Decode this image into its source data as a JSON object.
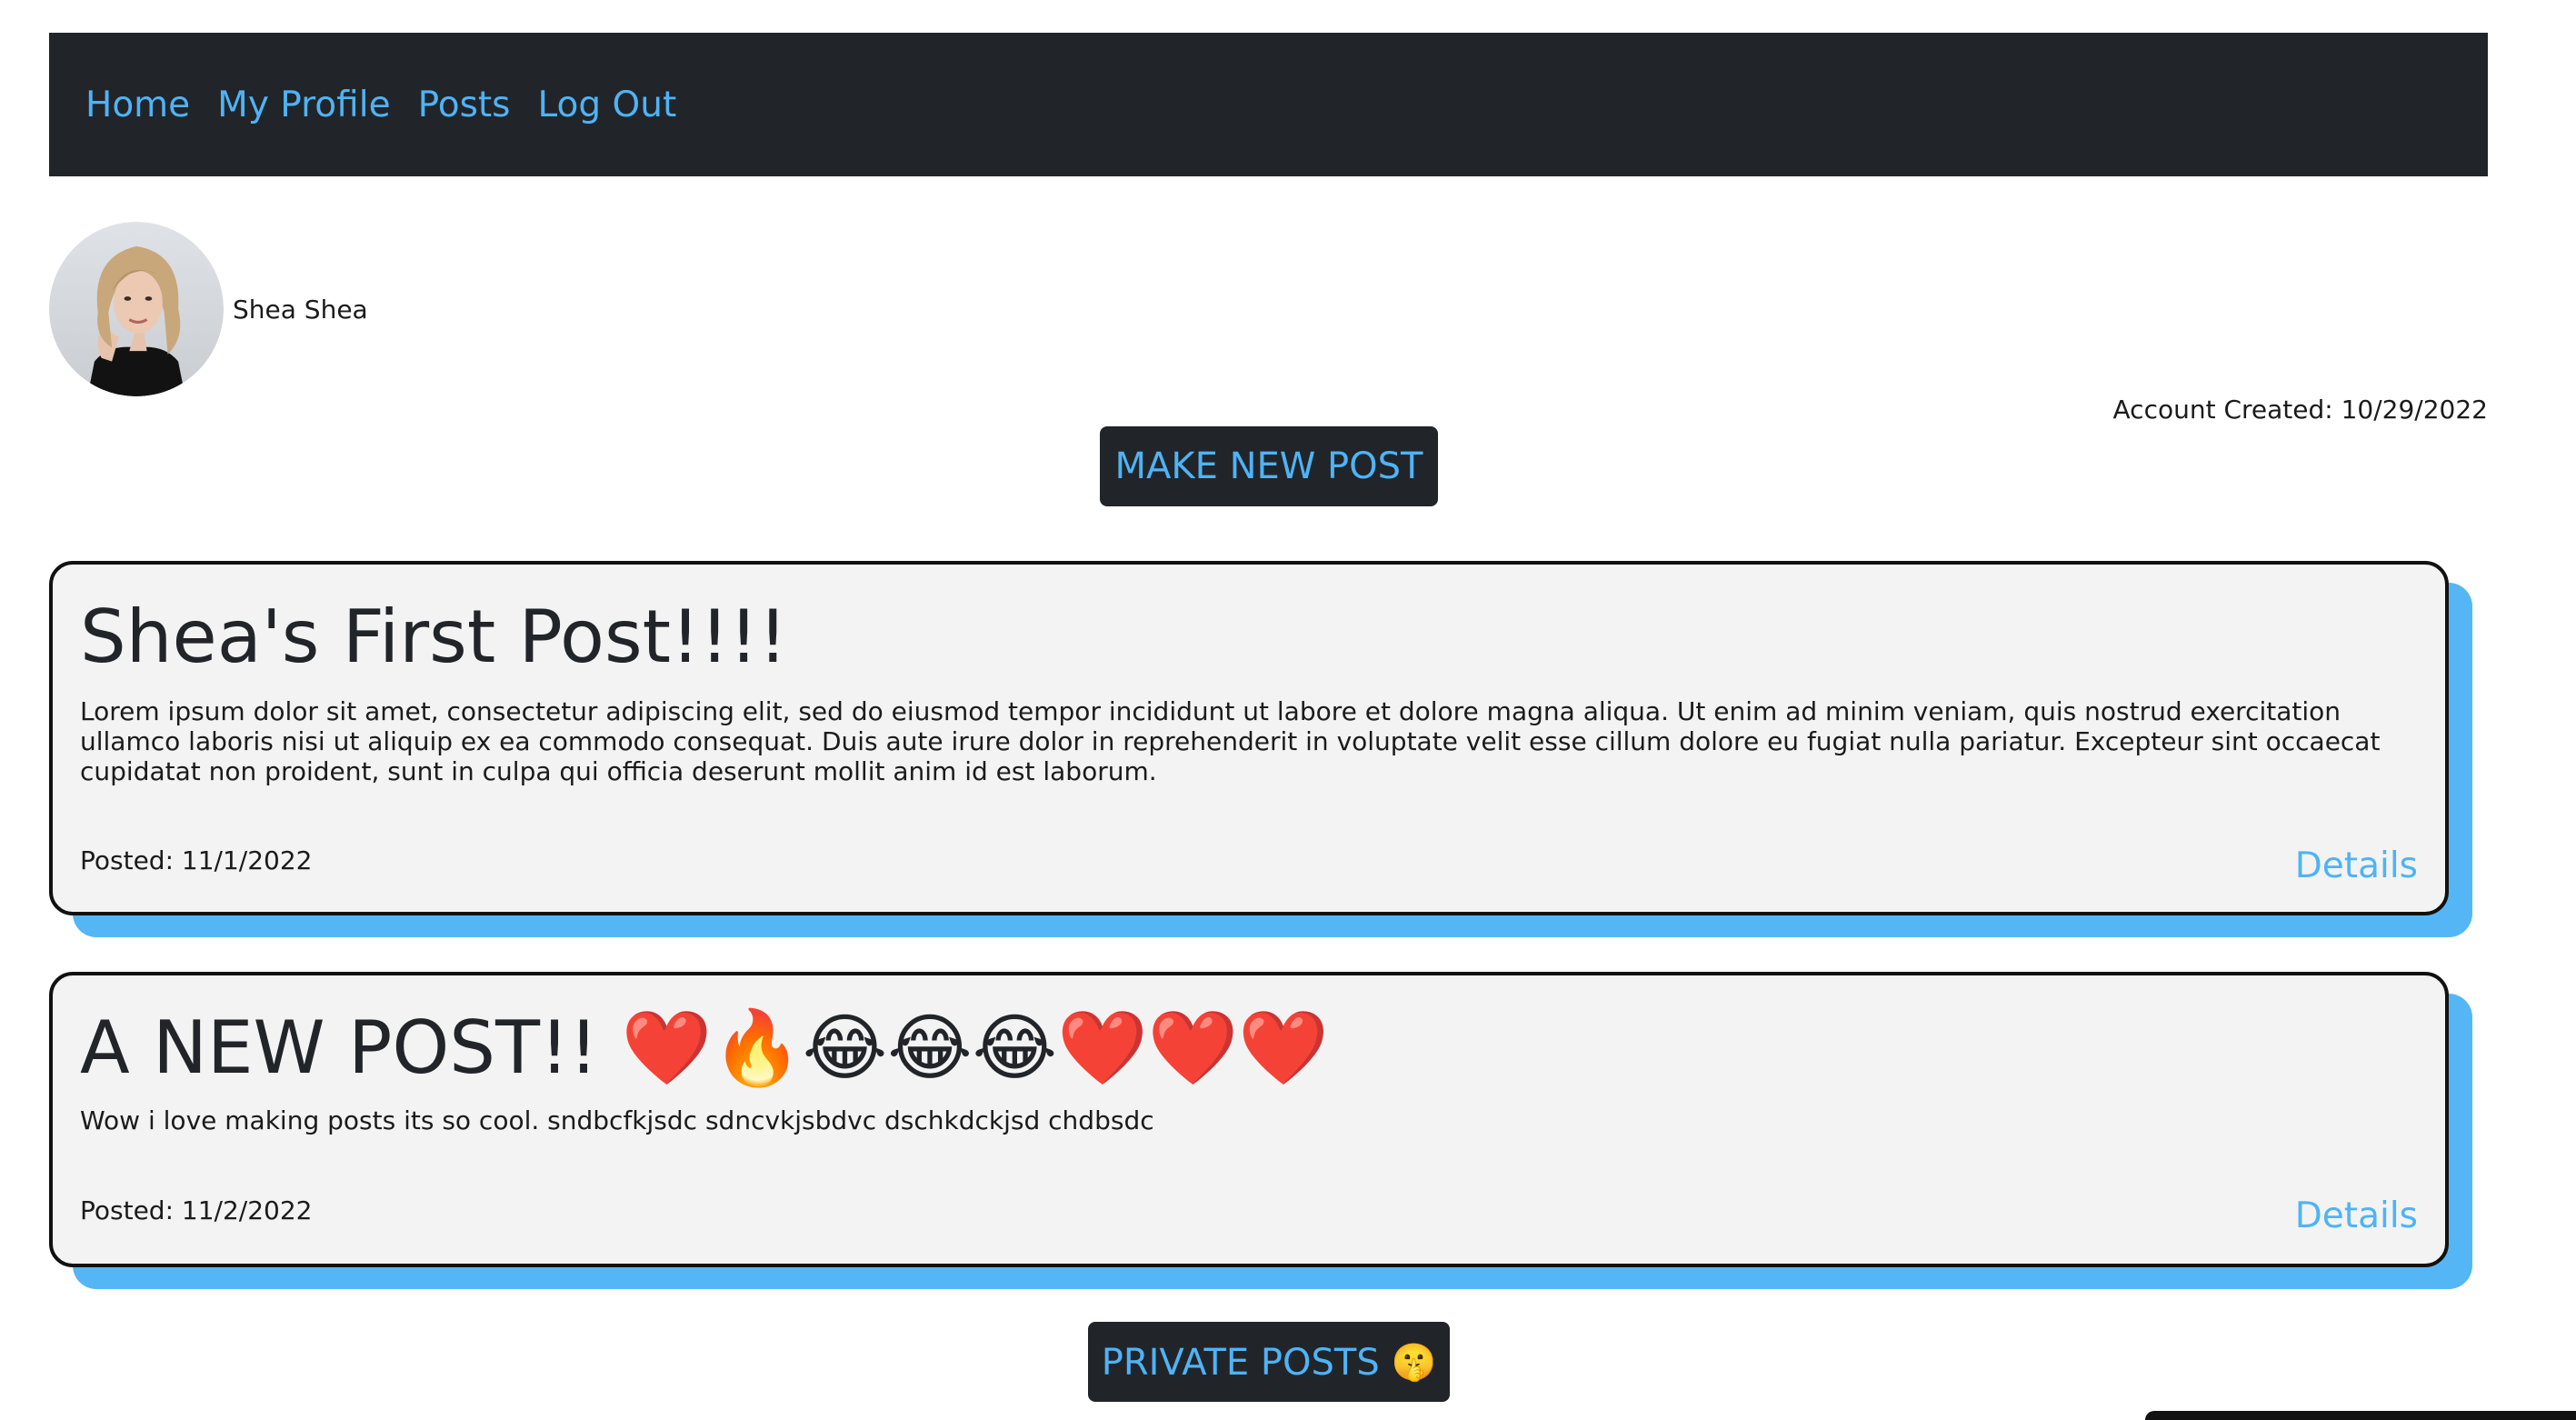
{
  "nav": {
    "links": [
      "Home",
      "My Profile",
      "Posts",
      "Log Out"
    ]
  },
  "profile": {
    "name": "Shea Shea",
    "account_created": "Account Created: 10/29/2022"
  },
  "actions": {
    "make_new_post": "MAKE NEW POST",
    "private_posts": "PRIVATE POSTS 🤫"
  },
  "posts": [
    {
      "title": "Shea's First Post!!!!",
      "body": "Lorem ipsum dolor sit amet, consectetur adipiscing elit, sed do eiusmod tempor incididunt ut labore et dolore magna aliqua. Ut enim ad minim veniam, quis nostrud exercitation ullamco laboris nisi ut aliquip ex ea commodo consequat. Duis aute irure dolor in reprehenderit in voluptate velit esse cillum dolore eu fugiat nulla pariatur. Excepteur sint occaecat cupidatat non proident, sunt in culpa qui officia deserunt mollit anim id est laborum.",
      "posted": "Posted: 11/1/2022",
      "details": "Details"
    },
    {
      "title": "A NEW POST!! ❤️🔥😂😂😂❤️❤️❤️",
      "body": "Wow i love making posts its so cool. sndbcfkjsdc sdncvkjsbdvc dschkdckjsd chdbsdc",
      "posted": "Posted: 11/2/2022",
      "details": "Details"
    }
  ],
  "colors": {
    "navbar_bg": "#212529",
    "link": "#4fb3f6",
    "card_shadow": "#55b6f5",
    "card_bg": "#f3f3f3"
  }
}
